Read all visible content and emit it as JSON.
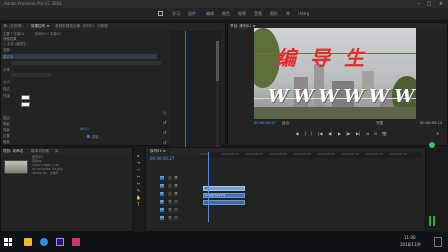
{
  "window": {
    "title": "Adobe Premiere Pro CC 2018"
  },
  "workspaces": {
    "items": [
      "学习",
      "组件",
      "编辑",
      "颜色",
      "效果",
      "音频",
      "图形",
      "库",
      "Untrg"
    ],
    "active_index": 1
  },
  "effect_controls": {
    "tabs": [
      "源: (无剪辑)",
      "效果控件 ≡",
      "音频剪辑混合器: 序列01",
      "元数据"
    ],
    "source_label": "主要 * 字幕01",
    "sequence_label": "序列01 * 字幕01",
    "rows": [
      "视频效果",
      "○ 文本 (编导生)",
      "变换",
      "源文本",
      "对齐",
      "字体",
      "大小",
      "描边",
      "",
      "外观",
      "填充",
      "描边",
      "阴影",
      "背景",
      "变换",
      "位置",
      "缩放",
      "旋转"
    ],
    "checkbox_label": "阴影",
    "value_text": "100.0"
  },
  "program_monitor": {
    "tab": "节目: 序列01 ≡",
    "title_chinese": "编导生",
    "title_w": "WWWWWW",
    "timecode_left": "00:00:00:27",
    "fit_label": "适合",
    "quality_label": "完整",
    "timecode_right": "00:00:00:14",
    "controls": [
      "◆",
      "{",
      "}",
      "|◀",
      "◀|",
      "▶",
      "|▶",
      "▶|",
      "⇲",
      "⊡",
      "📷",
      "+"
    ]
  },
  "project_panel": {
    "tabs": [
      "项目: 未命名",
      "媒体浏览器",
      "库"
    ],
    "clip_name": "序列01",
    "clip_info": [
      "序列01",
      "1920 x 1080 (1.0)",
      "00;00;00;28, 25.00p",
      "48000 Hz - 立体声"
    ]
  },
  "timeline": {
    "tab": "序列01 ≡",
    "timecode": "00:00:00:27",
    "ruler": [
      "00:00",
      "00:00:00:10",
      "00:00:00:15",
      "00:00:00:20",
      "00:00:01:00",
      "00:00:01:05",
      "00:00:01:10",
      "00:00:01:15",
      "00:00:01:20"
    ],
    "tracks": [
      {
        "name": "V3",
        "btns": [
          "V3",
          "○",
          "👁"
        ]
      },
      {
        "name": "V2",
        "btns": [
          "V2",
          "○",
          "👁"
        ]
      },
      {
        "name": "V1",
        "btns": [
          "V1",
          "○",
          "👁"
        ]
      },
      {
        "name": "A1",
        "btns": [
          "A1",
          "M",
          "S"
        ]
      },
      {
        "name": "A2",
        "btns": [
          "A2",
          "M",
          "S"
        ]
      },
      {
        "name": "A3",
        "btns": [
          "A3",
          "M",
          "S"
        ]
      }
    ],
    "clips": [
      {
        "label": "fx",
        "track": "V2"
      },
      {
        "label": "fx 剪辑 mp4 [V]",
        "track": "V1"
      },
      {
        "label": "",
        "track": "A1"
      }
    ]
  },
  "taskbar": {
    "tray_time": "11:00",
    "tray_date": "2018/11/9",
    "apps": [
      "windows-start",
      "file-explorer",
      "media-player",
      "premiere-pro",
      "app-icon"
    ]
  }
}
